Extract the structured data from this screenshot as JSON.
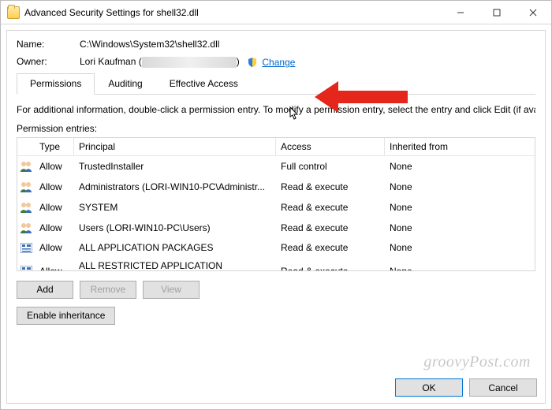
{
  "window": {
    "title": "Advanced Security Settings for shell32.dll"
  },
  "header": {
    "name_label": "Name:",
    "name_value": "C:\\Windows\\System32\\shell32.dll",
    "owner_label": "Owner:",
    "owner_name": "Lori Kaufman (",
    "owner_close_paren": ")",
    "change_link": "Change"
  },
  "tabs": [
    {
      "label": "Permissions",
      "active": true
    },
    {
      "label": "Auditing",
      "active": false
    },
    {
      "label": "Effective Access",
      "active": false
    }
  ],
  "info_text": "For additional information, double-click a permission entry. To modify a permission entry, select the entry and click Edit (if availa",
  "entries_label": "Permission entries:",
  "columns": {
    "type": "Type",
    "principal": "Principal",
    "access": "Access",
    "inherited": "Inherited from"
  },
  "entries": [
    {
      "icon": "users",
      "type": "Allow",
      "principal": "TrustedInstaller",
      "access": "Full control",
      "inherited": "None"
    },
    {
      "icon": "users",
      "type": "Allow",
      "principal": "Administrators (LORI-WIN10-PC\\Administr...",
      "access": "Read & execute",
      "inherited": "None"
    },
    {
      "icon": "users",
      "type": "Allow",
      "principal": "SYSTEM",
      "access": "Read & execute",
      "inherited": "None"
    },
    {
      "icon": "users",
      "type": "Allow",
      "principal": "Users (LORI-WIN10-PC\\Users)",
      "access": "Read & execute",
      "inherited": "None"
    },
    {
      "icon": "pkg",
      "type": "Allow",
      "principal": "ALL APPLICATION PACKAGES",
      "access": "Read & execute",
      "inherited": "None"
    },
    {
      "icon": "pkg",
      "type": "Allow",
      "principal": "ALL RESTRICTED APPLICATION PACKAGES",
      "access": "Read & execute",
      "inherited": "None"
    }
  ],
  "buttons": {
    "add": "Add",
    "remove": "Remove",
    "view": "View",
    "enable_inheritance": "Enable inheritance",
    "ok": "OK",
    "cancel": "Cancel"
  },
  "watermark": "groovyPost.com"
}
